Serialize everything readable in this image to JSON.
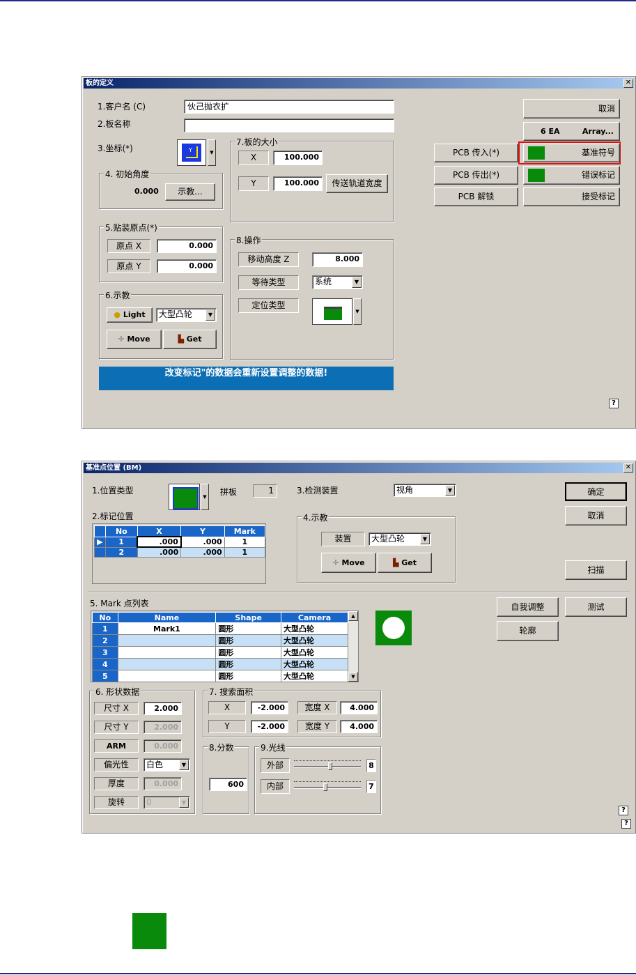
{
  "dialog1": {
    "title": "板的定义",
    "customer_label": "1.客户名 (C)",
    "customer_value": "伙己抛衣扩",
    "board_label": "2.板名称",
    "board_value": "",
    "coord_label": "3.坐标(*)",
    "angle_group": "4. 初始角度",
    "angle_value": "0.000",
    "teach_btn": "示教...",
    "size_group": "7.板的大小",
    "size_x_label": "X",
    "size_x_value": "100.000",
    "size_y_label": "Y",
    "size_y_value": "100.000",
    "rail_btn": "传送轨道宽度",
    "origin_group": "5.贴装原点(*)",
    "origin_x_label": "原点 X",
    "origin_x_value": "0.000",
    "origin_y_label": "原点 Y",
    "origin_y_value": "0.000",
    "teach_group": "6.示教",
    "light_btn": "Light",
    "camera_combo": "大型凸轮",
    "move_btn": "Move",
    "get_btn": "Get",
    "op_group": "8.操作",
    "move_height_label": "移动高度 Z",
    "move_height_value": "8.000",
    "wait_type_label": "等待类型",
    "wait_type_value": "系统",
    "pos_type_label": "定位类型",
    "banner": "改变标记\"的数据会重新设置调整的数据!",
    "cancel_btn": "取消",
    "ea_label": "6 EA",
    "array_btn": "Array...",
    "pcb_in_btn": "PCB 传入(*)",
    "pcb_out_btn": "PCB 传出(*)",
    "pcb_unlock_btn": "PCB 解锁",
    "fiducial_btn": "基准符号",
    "error_mark_btn": "错误标记",
    "accept_mark_btn": "接受标记",
    "help": "?"
  },
  "dialog2": {
    "title": "基准点位置 (BM)",
    "pos_type_label": "1.位置类型",
    "panel_label": "拼板",
    "panel_value": "1",
    "detect_label": "3.检测装置",
    "detect_value": "视角",
    "ok_btn": "确定",
    "cancel_btn": "取消",
    "scan_btn": "扫描",
    "mark_pos_label": "2.标记位置",
    "mark_pos_headers": [
      "No",
      "X",
      "Y",
      "Mark"
    ],
    "mark_pos_rows": [
      {
        "no": "1",
        "x": ".000",
        "y": ".000",
        "mark": "1"
      },
      {
        "no": "2",
        "x": ".000",
        "y": ".000",
        "mark": "1"
      }
    ],
    "teach_group": "4.示教",
    "device_label": "装置",
    "device_value": "大型凸轮",
    "move_btn": "Move",
    "get_btn": "Get",
    "mark_list_label": "5. Mark 点列表",
    "mark_list_headers": [
      "No",
      "Name",
      "Shape",
      "Camera"
    ],
    "mark_list_rows": [
      {
        "no": "1",
        "name": "Mark1",
        "shape": "圆形",
        "camera": "大型凸轮"
      },
      {
        "no": "2",
        "name": "",
        "shape": "圆形",
        "camera": "大型凸轮"
      },
      {
        "no": "3",
        "name": "",
        "shape": "圆形",
        "camera": "大型凸轮"
      },
      {
        "no": "4",
        "name": "",
        "shape": "圆形",
        "camera": "大型凸轮"
      },
      {
        "no": "5",
        "name": "",
        "shape": "圆形",
        "camera": "大型凸轮"
      }
    ],
    "self_adjust_btn": "自我调整",
    "test_btn": "测试",
    "contour_btn": "轮廓",
    "shape_group": "6. 形状数据",
    "size_x_label": "尺寸 X",
    "size_x_value": "2.000",
    "size_y_label": "尺寸 Y",
    "size_y_value": "2.000",
    "arm_label": "ARM",
    "arm_value": "0.000",
    "polarity_label": "偏光性",
    "polarity_value": "白色",
    "thickness_label": "厚度",
    "thickness_value": "0.000",
    "rotate_label": "旋转",
    "rotate_value": "0",
    "search_group": "7. 搜索面积",
    "search_x_label": "X",
    "search_x_value": "-2.000",
    "search_w_label": "宽度 X",
    "search_w_value": "4.000",
    "search_y_label": "Y",
    "search_y_value": "-2.000",
    "search_h_label": "宽度 Y",
    "search_h_value": "4.000",
    "score_group": "8.分数",
    "score_value": "600",
    "light_group": "9.光线",
    "outer_label": "外部",
    "outer_value": "8",
    "inner_label": "内部",
    "inner_value": "7",
    "help": "?"
  },
  "colors": {
    "accent": "#0c6eb5",
    "green": "#0a8a0a",
    "highlight": "#e01010",
    "header": "#1a66c8"
  }
}
